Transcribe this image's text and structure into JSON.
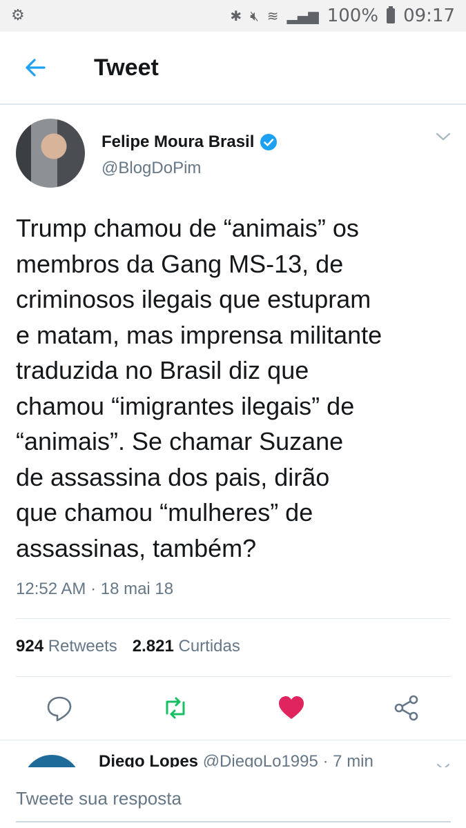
{
  "status_bar": {
    "battery": "100%",
    "time": "09:17",
    "icons": [
      "bluetooth-icon",
      "mute-icon",
      "wifi-icon",
      "signal-icon",
      "battery-icon"
    ]
  },
  "app_bar": {
    "title": "Tweet",
    "back_icon": "back-arrow-icon"
  },
  "tweet": {
    "author_name": "Felipe Moura Brasil",
    "handle": "@BlogDoPim",
    "verified": true,
    "text_lines": [
      "Trump chamou de “animais” os",
      "membros da Gang MS-13, de",
      "criminosos ilegais que estupram",
      "e matam, mas imprensa militante",
      "traduzida no Brasil diz que",
      "chamou “imigrantes ilegais” de",
      "“animais”. Se chamar Suzane",
      "de assassina dos pais, dirão",
      "que chamou “mulheres” de",
      "assassinas, também?"
    ],
    "timestamp": "12:52 AM · 18 mai 18",
    "retweets_count": "924",
    "retweets_label": "Retweets",
    "likes_count": "2.821",
    "likes_label": "Curtidas"
  },
  "actions": [
    "reply-icon",
    "retweet-icon",
    "like-icon",
    "share-icon"
  ],
  "colors": {
    "accent": "#1da1f2",
    "retweet": "#17bf63",
    "like": "#e0245e",
    "secondary_text": "#657786"
  },
  "reply": {
    "name": "Diego Lopes",
    "handle": "@DiegoLo1995",
    "time": "· 7 min"
  },
  "composer": {
    "placeholder": "Tweete sua resposta"
  }
}
